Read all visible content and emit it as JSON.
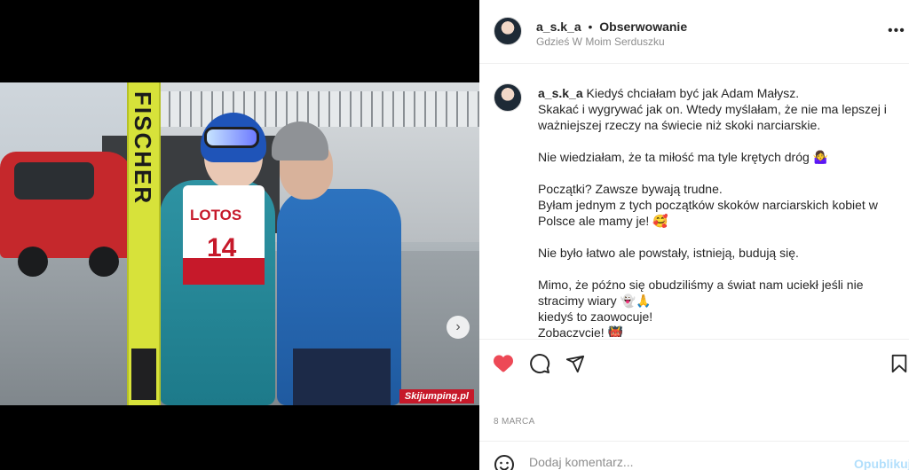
{
  "header": {
    "username": "a_s.k_a",
    "separator": "•",
    "follow_label": "Obserwowanie",
    "location": "Gdzieś W Moim Serduszku",
    "more_label": "•••"
  },
  "photo": {
    "ski_brand": "FISCHER",
    "bib_sponsor": "LOTOS",
    "bib_number": "14",
    "watermark": "Skijumping.pl",
    "carousel_next_icon": "›",
    "carousel_dots": 3,
    "carousel_active_index": 0
  },
  "caption": {
    "username": "a_s.k_a",
    "text": " Kiedyś chciałam być jak Adam Małysz.\nSkakać i wygrywać jak on. Wtedy myślałam, że nie ma lepszej i ważniejszej rzeczy na świecie niż skoki narciarskie.\n\nNie wiedziałam, że ta miłość ma tyle krętych dróg 🤷‍♀️\n\nPoczątki? Zawsze bywają trudne.\nByłam jednym z tych początków skoków narciarskich kobiet w Polsce ale mamy je! 🥰\n\nNie było łatwo ale powstały, istnieją, budują się.\n\nMimo, że późno się obudziliśmy a świat nam uciekł jeśli nie stracimy wiary 👻🙏\nkiedyś to zaowocuje!\nZobaczycie! 👹"
  },
  "actions": {
    "like_icon": "heart-filled",
    "comment_icon": "comment-bubble",
    "share_icon": "paper-plane",
    "save_icon": "bookmark",
    "like_color": "#ed4956"
  },
  "date": "8 MARCA",
  "comment_box": {
    "placeholder": "Dodaj komentarz...",
    "post_label": "Opublikuj"
  }
}
